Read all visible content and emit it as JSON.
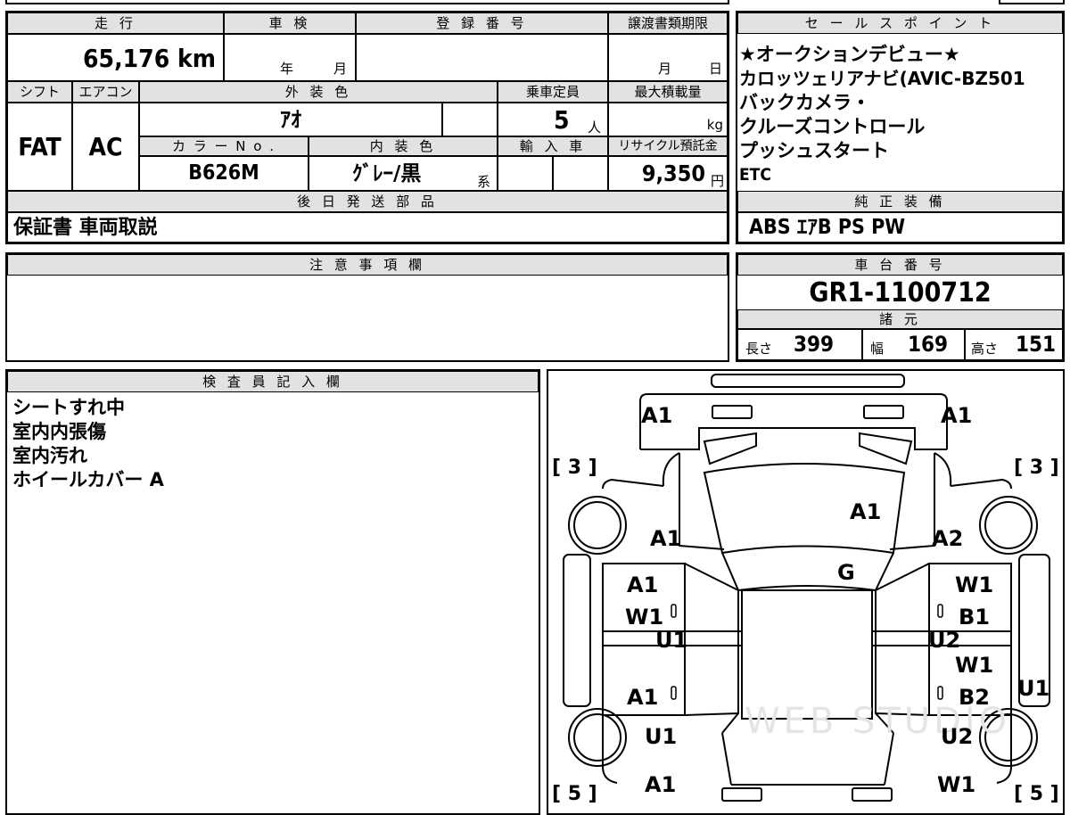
{
  "vehicle": {
    "mileage_label": "走 行",
    "mileage_value": "65,176",
    "mileage_unit": "km",
    "inspection_label": "車 検",
    "inspection_year": "年",
    "inspection_month": "月",
    "registration_label": "登 録 番 号",
    "transfer_label": "譲渡書類期限",
    "transfer_month": "月",
    "transfer_day": "日",
    "shift_label": "シフト",
    "shift_value": "FAT",
    "ac_label": "エアコン",
    "ac_value": "AC",
    "exterior_color_label": "外 装 色",
    "exterior_color_value": "ｱｵ",
    "capacity_label": "乗車定員",
    "capacity_value": "5",
    "capacity_unit": "人",
    "max_load_label": "最大積載量",
    "max_load_unit": "kg",
    "color_no_label": "カ ラ ー N o .",
    "color_no_value": "B626M",
    "interior_color_label": "内 装 色",
    "interior_color_value": "ｸﾞﾚｰ/黒",
    "interior_color_suffix": "系",
    "import_label": "輸 入 車",
    "recycle_label": "リサイクル預託金",
    "recycle_value": "9,350",
    "recycle_unit": "円"
  },
  "later_parts": {
    "label": "後 日 発 送 部 品",
    "value": "保証書 車両取説"
  },
  "notes": {
    "label": "注 意 事 項 欄"
  },
  "sales_points": {
    "label": "セ ー ル ス ポ イ ン ト",
    "lines": [
      "★オークションデビュー★",
      "カロッツェリアナビ(AVIC-BZ501",
      "バックカメラ・",
      "クルーズコントロール",
      "プッシュスタート",
      "ETC"
    ]
  },
  "standard_equipment": {
    "label": "純 正 装 備",
    "value": "ABS ｴｱB PS PW"
  },
  "chassis": {
    "label": "車 台 番 号",
    "value": "GR1-1100712"
  },
  "specs": {
    "label": "諸 元",
    "length_label": "長さ",
    "length_value": "399",
    "width_label": "幅",
    "width_value": "169",
    "height_label": "高さ",
    "height_value": "151"
  },
  "inspector": {
    "label": "検 査 員 記 入 欄",
    "lines": [
      "シートすれ中",
      "室内内張傷",
      "室内汚れ",
      "ホイールカバー A"
    ]
  },
  "diagram": {
    "marks": [
      "A1",
      "A1",
      "[ 3 ]",
      "[ 3 ]",
      "A1",
      "A1",
      "A2",
      "G",
      "A1",
      "W1",
      "W1",
      "B1",
      "U1",
      "U2",
      "W1",
      "A1",
      "B2",
      "U1",
      "U1",
      "U2",
      "A1",
      "W1",
      "[ 5 ]",
      "[ 5 ]"
    ],
    "watermark": "WEB STUDIO"
  }
}
